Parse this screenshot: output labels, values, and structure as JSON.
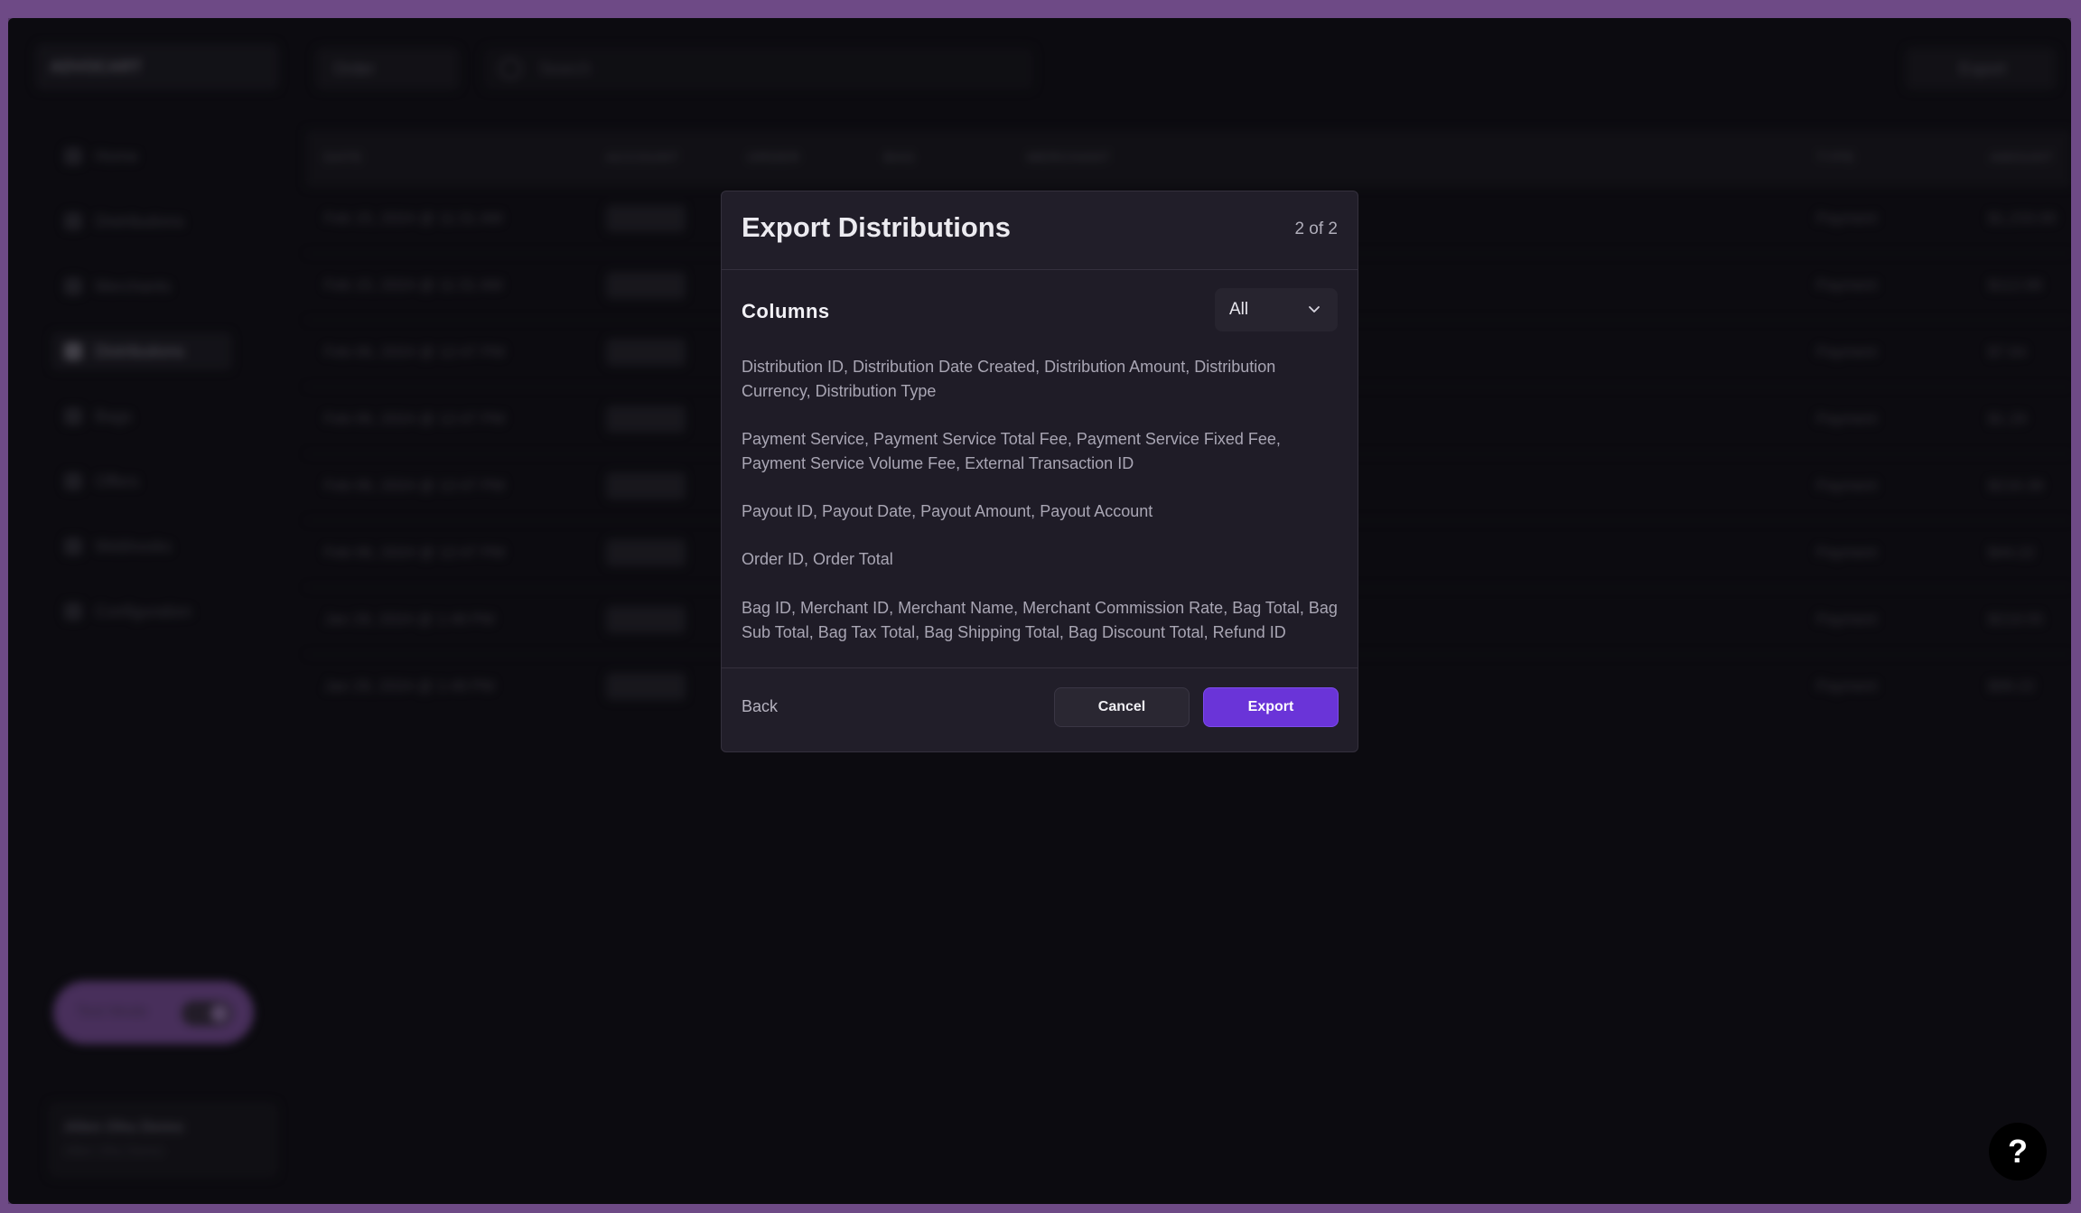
{
  "background": {
    "account_label": "ADVOCART",
    "nav": [
      "Home",
      "Distributions",
      "Merchants",
      "Distributions",
      "Bags",
      "Offers",
      "Webhooks",
      "Configuration"
    ],
    "filter_label": "Order",
    "search_placeholder": "Search",
    "export_label": "Export",
    "table_headers": [
      "DATE",
      "ACCOUNT",
      "ORDER",
      "BAG",
      "MERCHANT",
      "TYPE",
      "AMOUNT"
    ],
    "rows": [
      {
        "date": "Feb 15, 2024 @ 11:31 AM",
        "type": "Payment",
        "amount": "$1,233.00"
      },
      {
        "date": "Feb 15, 2024 @ 11:31 AM",
        "type": "Payment",
        "amount": "$112.88"
      },
      {
        "date": "Feb 06, 2024 @ 12:47 PM",
        "type": "Payment",
        "amount": "$7.64"
      },
      {
        "date": "Feb 06, 2024 @ 12:47 PM",
        "type": "Payment",
        "amount": "$1.29"
      },
      {
        "date": "Feb 06, 2024 @ 12:47 PM",
        "type": "Payment",
        "amount": "$216.38"
      },
      {
        "date": "Feb 06, 2024 @ 12:47 PM",
        "type": "Payment",
        "amount": "$44.22"
      },
      {
        "date": "Jan 29, 2024 @ 1:49 PM",
        "type": "Payment",
        "amount": "$219.55"
      },
      {
        "date": "Jan 29, 2024 @ 1:49 PM",
        "type": "Payment",
        "amount": "$99.22"
      }
    ],
    "test_mode_label": "Test Mode",
    "user_name": "Allen Ohu Demo",
    "user_sub": "Allen Ohu Demo"
  },
  "modal": {
    "title": "Export Distributions",
    "step": "2 of 2",
    "columns_label": "Columns",
    "columns_filter": "All",
    "groups": [
      "Distribution ID, Distribution Date Created, Distribution Amount, Distribution Currency, Distribution Type",
      "Payment Service, Payment Service Total Fee, Payment Service Fixed Fee, Payment Service Volume Fee, External Transaction ID",
      "Payout ID, Payout Date, Payout Amount, Payout Account",
      "Order ID, Order Total",
      "Bag ID, Merchant ID, Merchant Name, Merchant Commission Rate, Bag Total, Bag Sub Total, Bag Tax Total, Bag Shipping Total, Bag Discount Total, Refund ID"
    ],
    "back_label": "Back",
    "cancel_label": "Cancel",
    "export_label": "Export"
  },
  "help_label": "?",
  "colors": {
    "accent": "#6a34d8",
    "frame": "#6e4a86",
    "modal_bg": "#211e29"
  }
}
